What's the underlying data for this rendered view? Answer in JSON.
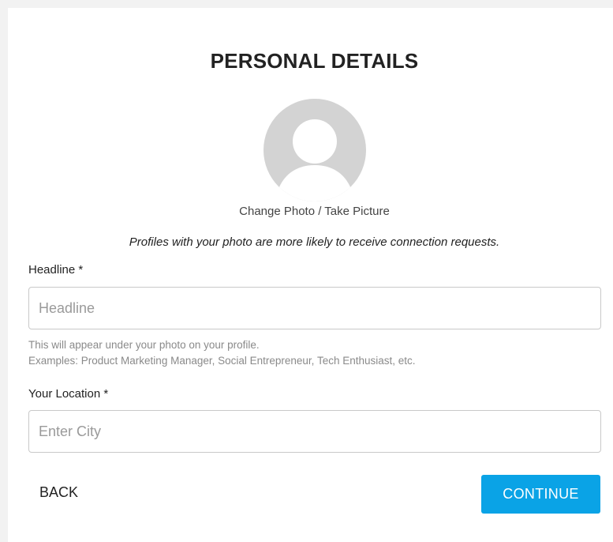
{
  "page": {
    "title": "PERSONAL DETAILS"
  },
  "photo": {
    "avatar_icon": "user-silhouette-icon",
    "change_label": "Change Photo / Take Picture",
    "note": "Profiles with your photo are more likely to receive connection requests."
  },
  "headline": {
    "label": "Headline *",
    "value": "",
    "placeholder": "Headline",
    "hint_line1": "This will appear under your photo on your profile.",
    "hint_line2": "Examples: Product Marketing Manager, Social Entrepreneur, Tech Enthusiast, etc."
  },
  "location": {
    "label": "Your Location *",
    "value": "",
    "placeholder": "Enter City"
  },
  "actions": {
    "back_label": "BACK",
    "continue_label": "CONTINUE"
  },
  "colors": {
    "accent": "#0aa3e6",
    "avatar_bg": "#d3d3d3",
    "text": "#222222",
    "hint": "#8a8a8a"
  }
}
